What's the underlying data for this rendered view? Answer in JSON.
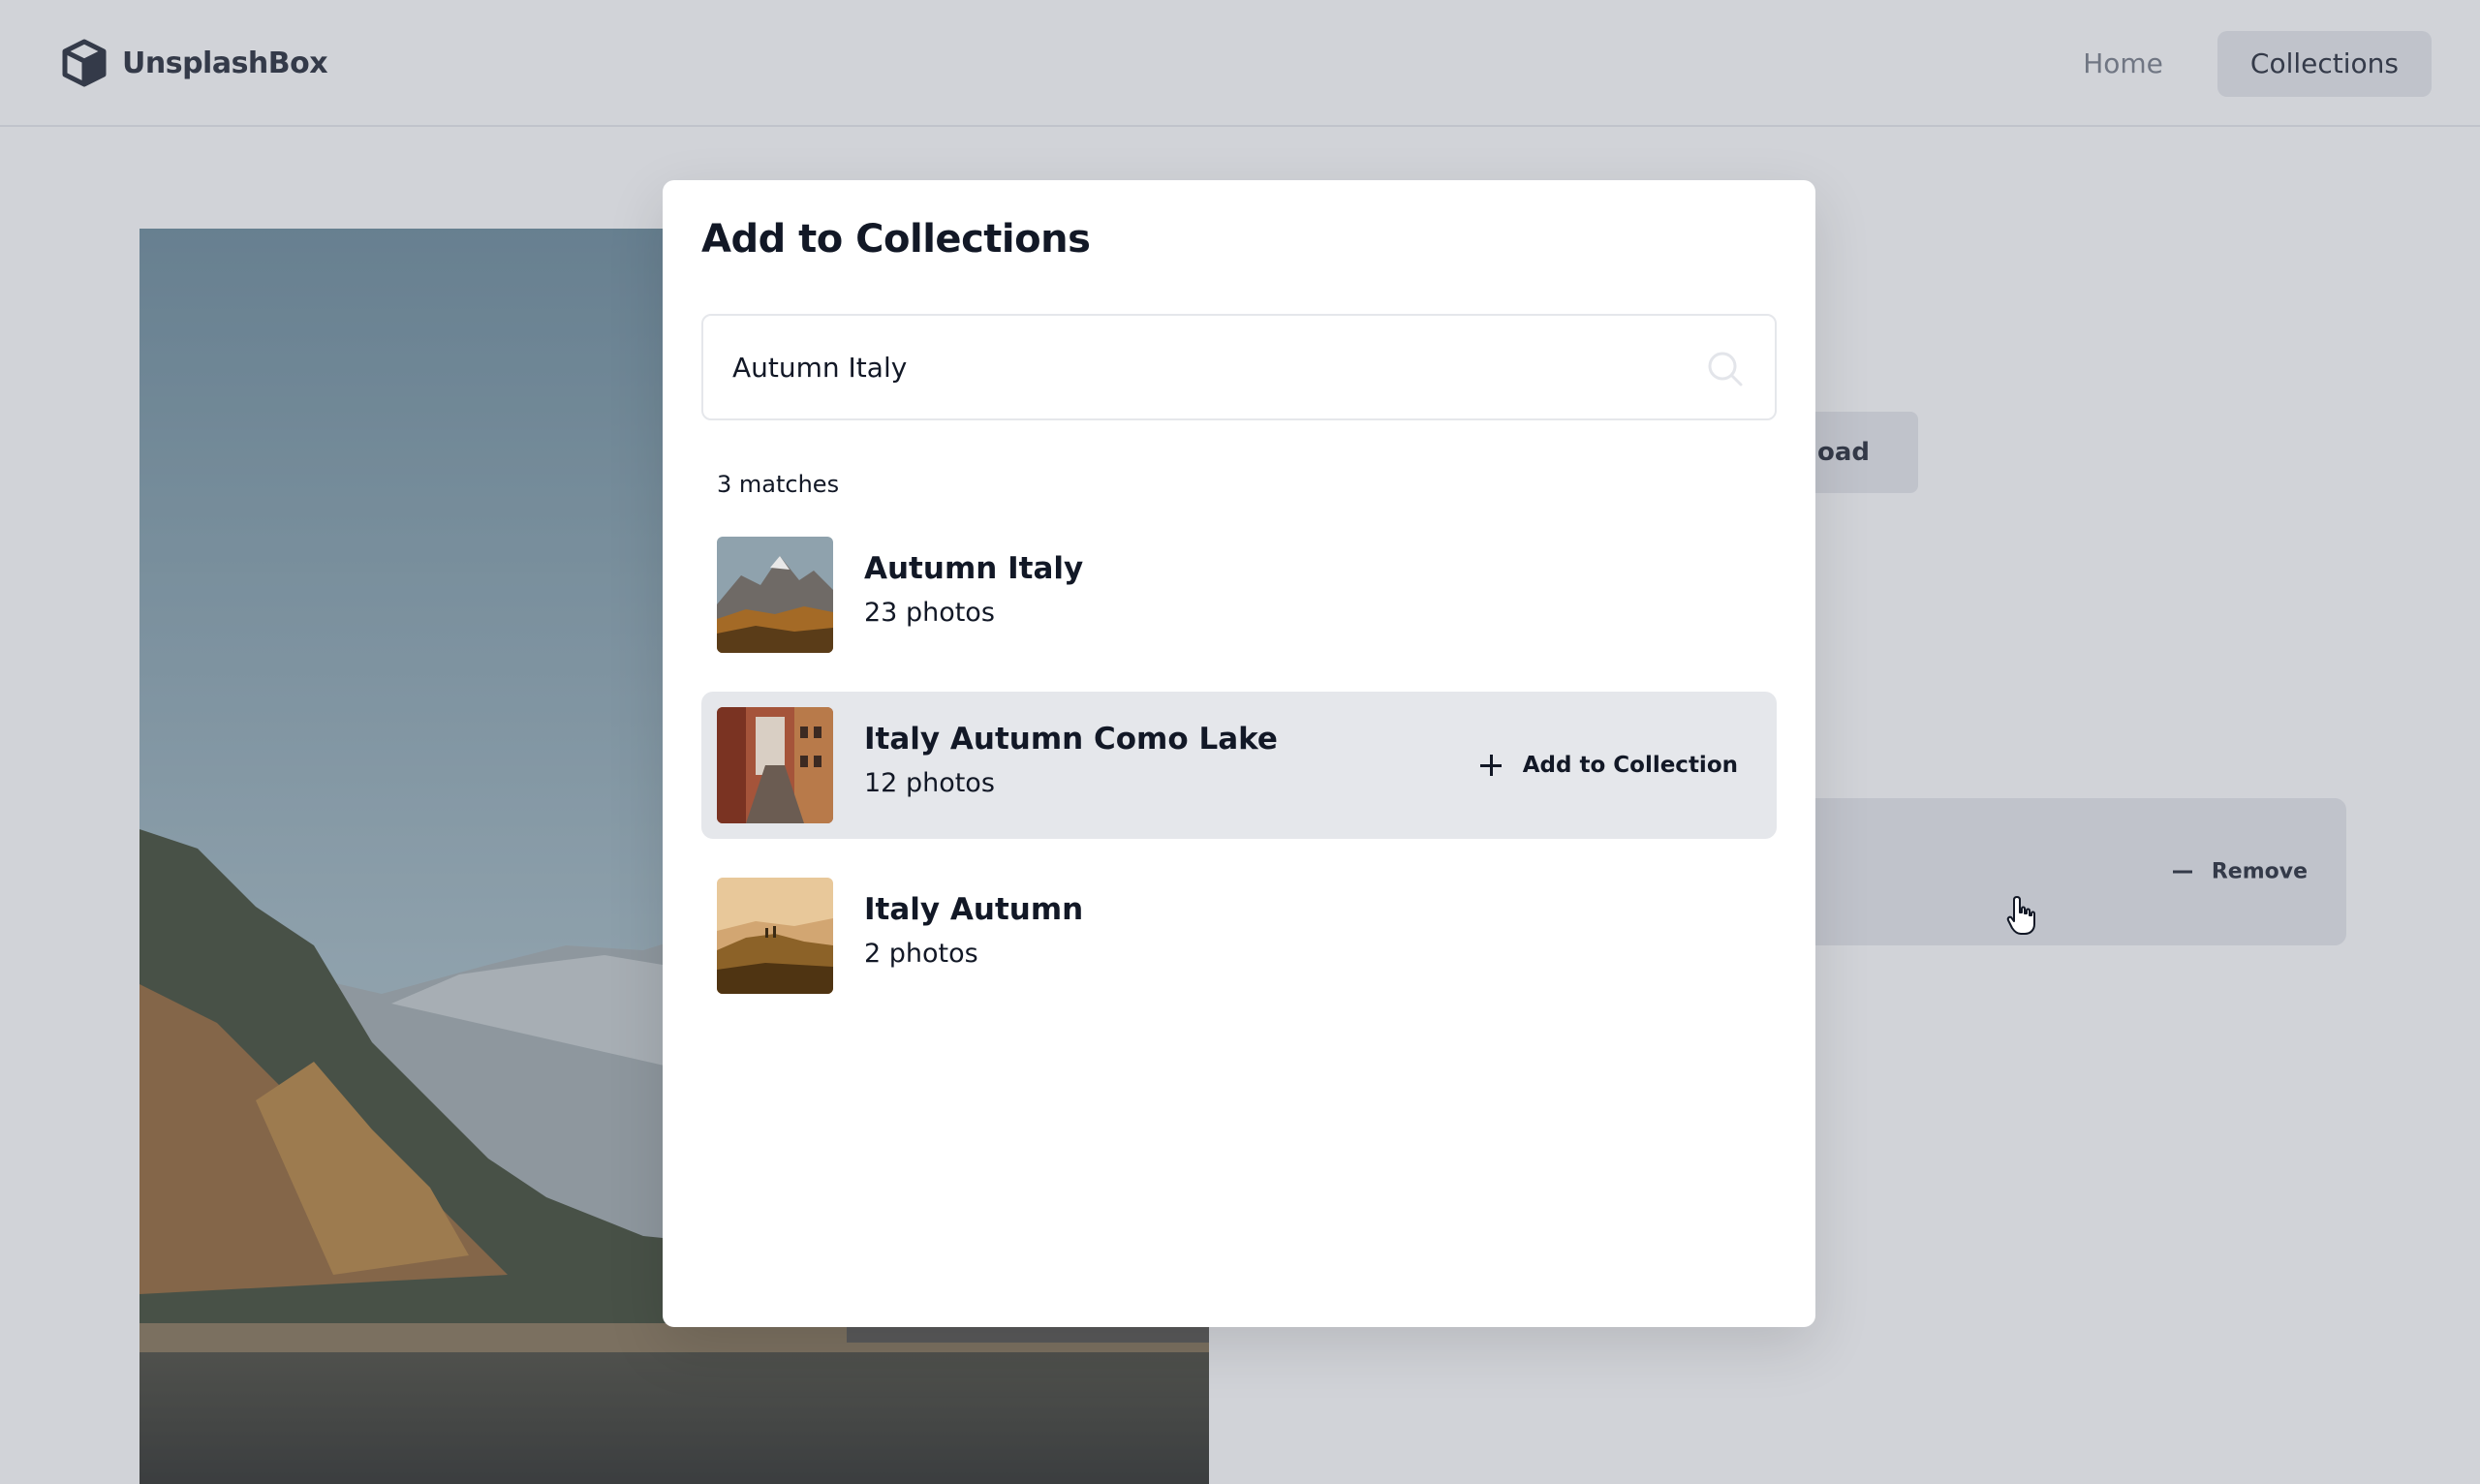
{
  "header": {
    "logo_text": "UnsplashBox",
    "nav": [
      {
        "label": "Home",
        "active": false
      },
      {
        "label": "Collections",
        "active": true
      }
    ]
  },
  "background": {
    "download_label": "load",
    "remove_label": "Remove"
  },
  "modal": {
    "title": "Add to Collections",
    "search": {
      "value": "Autumn Italy",
      "placeholder": ""
    },
    "matches_label": "3 matches",
    "results": [
      {
        "title": "Autumn Italy",
        "count": "23 photos",
        "thumb": "mountain-icon"
      },
      {
        "title": "Italy Autumn Como Lake",
        "count": "12 photos",
        "thumb": "street-icon",
        "action_label": "Add to Collection"
      },
      {
        "title": "Italy Autumn",
        "count": "2 photos",
        "thumb": "hills-icon"
      }
    ]
  },
  "colors": {
    "text": "#121826",
    "muted": "#6c727f",
    "surface": "#e5e7eb",
    "overlay": "#797f8e"
  }
}
